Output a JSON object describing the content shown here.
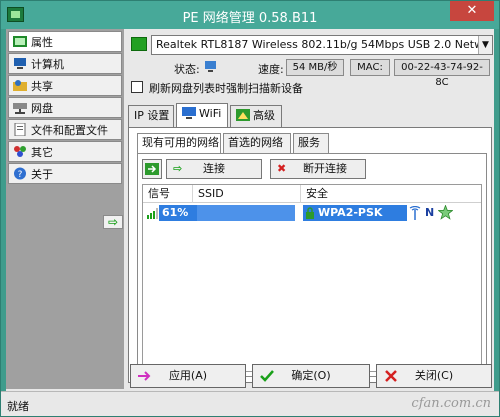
{
  "window": {
    "title": "PE 网络管理 0.58.B11",
    "close_glyph": "✕"
  },
  "sidebar": {
    "items": [
      {
        "label": "属性",
        "icon": "properties-icon"
      },
      {
        "label": "计算机",
        "icon": "computer-icon"
      },
      {
        "label": "共享",
        "icon": "share-icon"
      },
      {
        "label": "网盘",
        "icon": "network-drive-icon"
      },
      {
        "label": "文件和配置文件",
        "icon": "file-config-icon"
      },
      {
        "label": "其它",
        "icon": "other-icon"
      },
      {
        "label": "关于",
        "icon": "help-icon"
      }
    ],
    "arrow_glyph": "⇨"
  },
  "adapter": {
    "selected": "Realtek RTL8187 Wireless 802.11b/g 54Mbps USB 2.0 Network Adapter"
  },
  "status": {
    "state_label": "状态:",
    "speed_label": "速度:",
    "speed_value": "54 MB/秒",
    "mac_label": "MAC:",
    "mac_value": "00-22-43-74-92-8C"
  },
  "refresh_checkbox": {
    "label": "刷新网盘列表时强制扫描新设备",
    "checked": false
  },
  "tabs": [
    {
      "label": "IP 设置",
      "active": false
    },
    {
      "label": "WiFi",
      "active": true
    },
    {
      "label": "高级",
      "active": false
    }
  ],
  "wifi": {
    "subtabs": [
      {
        "label": "现有可用的网络",
        "active": true
      },
      {
        "label": "首选的网络",
        "active": false
      },
      {
        "label": "服务",
        "active": false
      }
    ],
    "connect_label": "连接",
    "disconnect_label": "断开连接",
    "columns": [
      "信号",
      "SSID",
      "安全"
    ],
    "networks": [
      {
        "signal": "61%",
        "signal_fraction": 0.61,
        "ssid": "",
        "security": "WPA2-PSK",
        "mode": "N"
      }
    ]
  },
  "buttons": {
    "apply": "应用(A)",
    "ok": "确定(O)",
    "close": "关闭(C)"
  },
  "statusbar": {
    "text": "就绪",
    "watermark": "cfan.com.cn"
  },
  "colors": {
    "title_bar": "#47a999",
    "selection": "#2e7de0",
    "ok_green": "#1aa01a",
    "cancel_red": "#d42020",
    "apply_magenta": "#d030c0"
  }
}
